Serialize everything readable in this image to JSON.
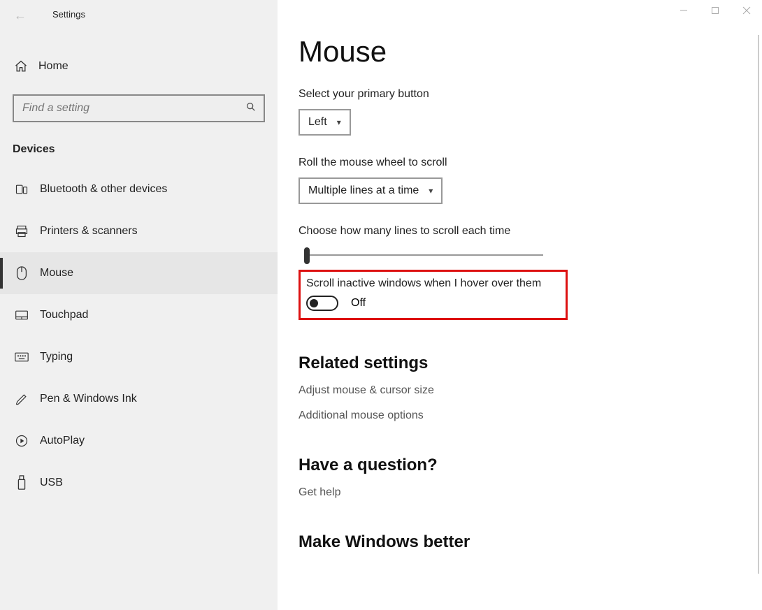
{
  "window": {
    "title": "Settings"
  },
  "sidebar": {
    "home": "Home",
    "search_placeholder": "Find a setting",
    "category": "Devices",
    "items": [
      {
        "label": "Bluetooth & other devices"
      },
      {
        "label": "Printers & scanners"
      },
      {
        "label": "Mouse"
      },
      {
        "label": "Touchpad"
      },
      {
        "label": "Typing"
      },
      {
        "label": "Pen & Windows Ink"
      },
      {
        "label": "AutoPlay"
      },
      {
        "label": "USB"
      }
    ]
  },
  "main": {
    "heading": "Mouse",
    "primary_button_label": "Select your primary button",
    "primary_button_value": "Left",
    "wheel_label": "Roll the mouse wheel to scroll",
    "wheel_value": "Multiple lines at a time",
    "lines_label": "Choose how many lines to scroll each time",
    "inactive_label": "Scroll inactive windows when I hover over them",
    "inactive_state": "Off",
    "related_heading": "Related settings",
    "related_links": [
      "Adjust mouse & cursor size",
      "Additional mouse options"
    ],
    "question_heading": "Have a question?",
    "question_link": "Get help",
    "improve_heading": "Make Windows better"
  }
}
